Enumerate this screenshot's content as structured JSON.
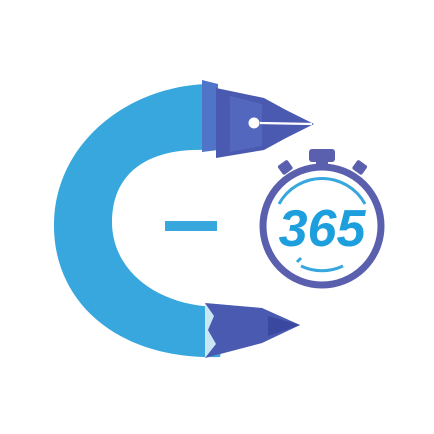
{
  "logo": {
    "number": "365",
    "icons": [
      "pen-nib-icon",
      "pencil-tip-icon",
      "stopwatch-icon"
    ],
    "colors": {
      "primary_blue": "#37a7de",
      "dark_blue": "#4a5ab0",
      "mid_blue": "#4f74c8",
      "light_blue": "#c9e6f5",
      "stopwatch_outline": "#5a5fae",
      "number_color": "#1e9fdd"
    }
  }
}
